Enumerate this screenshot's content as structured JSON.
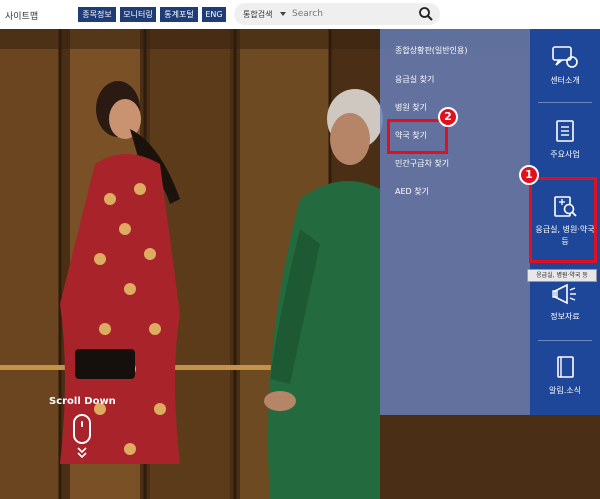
{
  "topbar": {
    "sitemap": "사이트맵",
    "buttons": [
      "종목정보",
      "모니터링",
      "통계포털",
      "ENG"
    ],
    "search": {
      "scope": "통합검색",
      "placeholder": "Search"
    }
  },
  "hero": {
    "scroll_label": "Scroll Down"
  },
  "submenu": {
    "items": [
      "종합상황판(일반인용)",
      "응급실 찾기",
      "병원 찾기",
      "약국 찾기",
      "민간구급차 찾기",
      "AED 찾기"
    ]
  },
  "sidebar": {
    "items": [
      {
        "label": "센터소개",
        "icon": "chat-bubble-icon"
      },
      {
        "label": "주요사업",
        "icon": "document-list-icon"
      },
      {
        "label": "응급실, 병원·약국 등",
        "icon": "search-document-icon"
      },
      {
        "label": "정보자료",
        "icon": "megaphone-icon"
      },
      {
        "label": "알림.소식",
        "icon": "book-icon"
      }
    ],
    "tooltip": "응급실, 병원·약국 등"
  },
  "annotations": {
    "badge1": "1",
    "badge2": "2",
    "color": "#e0101e"
  },
  "colors": {
    "sidebar": "#1e4799",
    "submenu": "#6880bc",
    "topbar_button": "#1d3c78"
  }
}
